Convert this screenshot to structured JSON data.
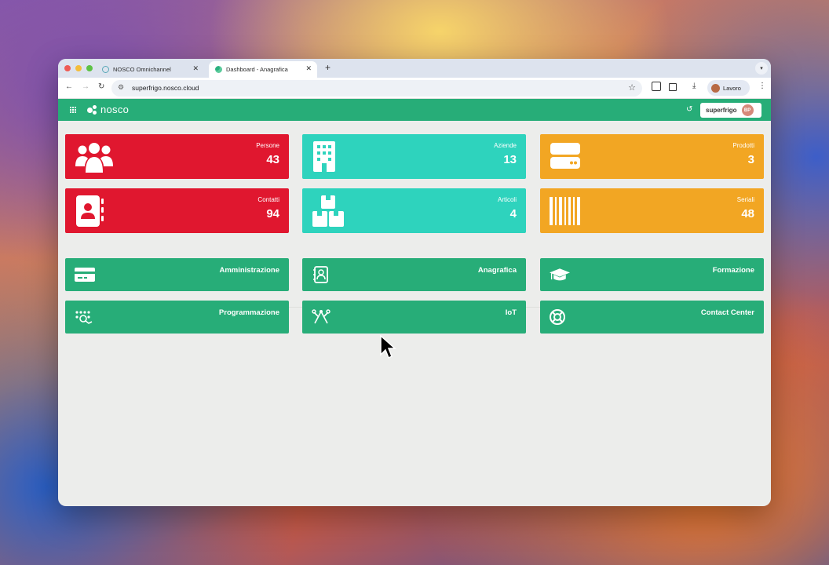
{
  "browser": {
    "tabs": [
      {
        "title": "NOSCO Omnichannel",
        "active": false
      },
      {
        "title": "Dashboard - Anagrafica",
        "active": true
      }
    ],
    "url": "superfrigo.nosco.cloud",
    "profile_name": "Lavoro"
  },
  "app": {
    "logo_text": "nosco",
    "user": {
      "name": "superfrigo",
      "initials": "BP"
    }
  },
  "stats": [
    {
      "label": "Persone",
      "value": "43",
      "color": "#e0172f",
      "icon": "people-icon"
    },
    {
      "label": "Aziende",
      "value": "13",
      "color": "#2ed3bd",
      "icon": "building-icon"
    },
    {
      "label": "Prodotti",
      "value": "3",
      "color": "#f2a623",
      "icon": "server-icon"
    },
    {
      "label": "Contatti",
      "value": "94",
      "color": "#e0172f",
      "icon": "address-book-icon"
    },
    {
      "label": "Articoli",
      "value": "4",
      "color": "#2ed3bd",
      "icon": "boxes-icon"
    },
    {
      "label": "Seriali",
      "value": "48",
      "color": "#f2a623",
      "icon": "barcode-icon"
    }
  ],
  "modules": [
    {
      "label": "Amministrazione",
      "icon": "credit-card-icon"
    },
    {
      "label": "Anagrafica",
      "icon": "contact-card-icon"
    },
    {
      "label": "Formazione",
      "icon": "graduation-cap-icon"
    },
    {
      "label": "Programmazione",
      "icon": "workflow-icon"
    },
    {
      "label": "IoT",
      "icon": "iot-icon"
    },
    {
      "label": "Contact Center",
      "icon": "lifebuoy-icon"
    }
  ],
  "colors": {
    "accent": "#27ad78",
    "red": "#e0172f",
    "teal": "#2ed3bd",
    "orange": "#f2a623"
  }
}
